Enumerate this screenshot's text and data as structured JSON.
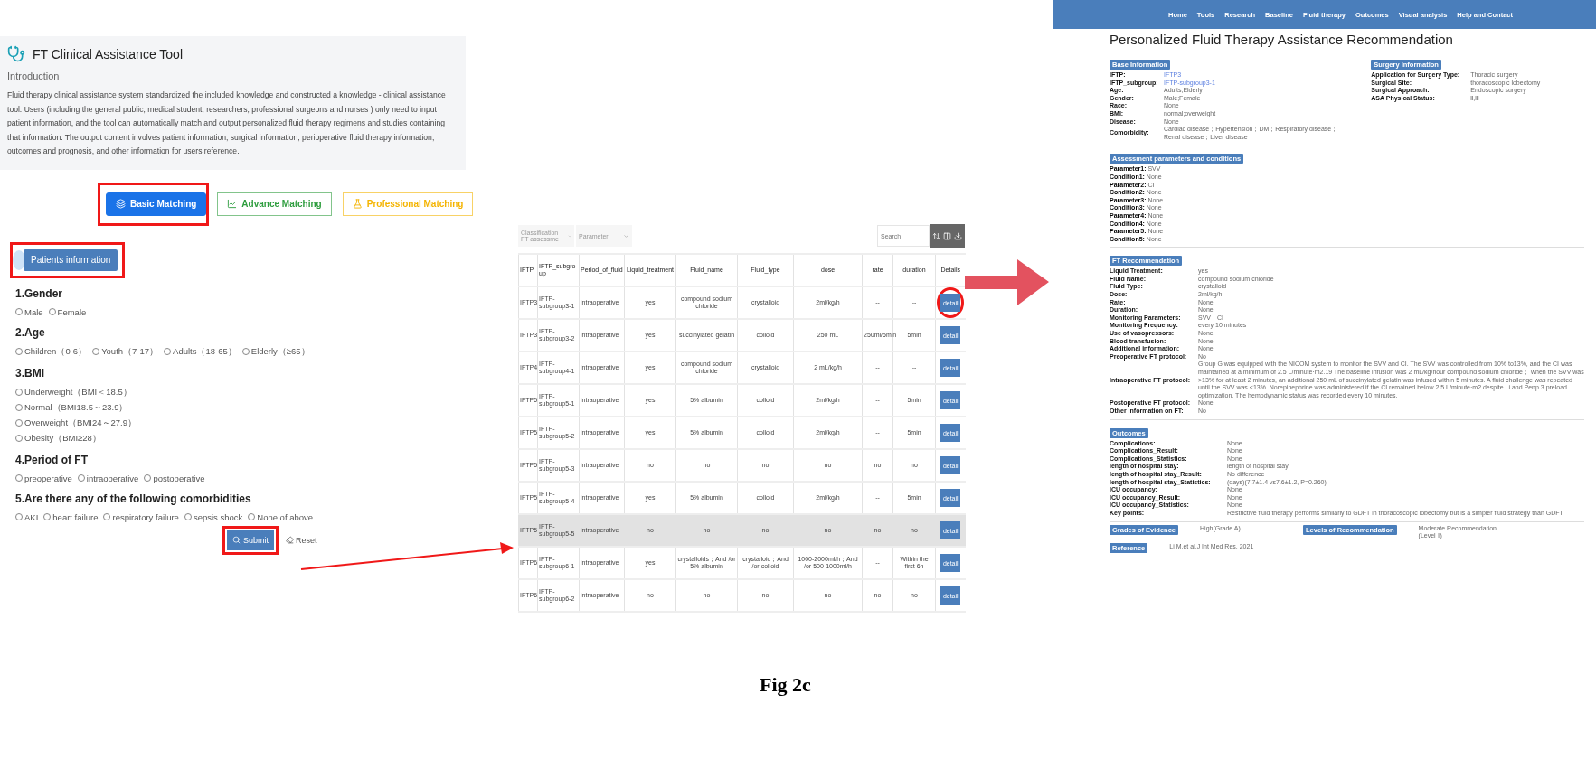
{
  "tool": {
    "title": "FT Clinical Assistance Tool",
    "intro_heading": "Introduction",
    "intro_text": "Fluid therapy clinical assistance system standardized the included knowledge and constructed a knowledge - clinical assistance tool. Users (including the general public, medical student, researchers, professional surgeons and nurses ) only need to input patient information, and the tool can automatically match and output personalized fluid therapy regimens and studies containing that information. The output content involves patient information, surgical information, perioperative fluid therapy information, outcomes and prognosis, and other information for users reference.",
    "modes": [
      {
        "label": "Basic Matching",
        "kind": "layers",
        "color": "#1a73e8",
        "selected": true,
        "annotated": true
      },
      {
        "label": "Advance Matching",
        "kind": "chart",
        "color": "#2e9d3e",
        "selected": false,
        "annotated": false
      },
      {
        "label": "Professional Matching",
        "kind": "flask",
        "color": "#f4b400",
        "selected": false,
        "annotated": false
      }
    ],
    "patients_button": {
      "label": "Patients information",
      "annotated": true
    },
    "questions": [
      {
        "title": "1.Gender",
        "inline": true,
        "options": [
          {
            "label": "Male",
            "selected": false
          },
          {
            "label": "Female",
            "selected": false
          }
        ]
      },
      {
        "title": "2.Age",
        "inline": true,
        "options": [
          {
            "label": "Children（0-6）",
            "selected": false
          },
          {
            "label": "Youth（7-17）",
            "selected": false
          },
          {
            "label": "Adults（18-65）",
            "selected": false
          },
          {
            "label": "Elderly（≥65）",
            "selected": false
          }
        ]
      },
      {
        "title": "3.BMI",
        "inline": false,
        "options": [
          {
            "label": "Underweight（BMI＜18.5）",
            "selected": false
          },
          {
            "label": "Normal（BMI18.5～23.9）",
            "selected": false
          },
          {
            "label": "Overweight（BMI24～27.9）",
            "selected": false
          },
          {
            "label": "Obesity（BMI≥28）",
            "selected": false
          }
        ]
      },
      {
        "title": "4.Period of FT",
        "inline": true,
        "options": [
          {
            "label": "preoperative",
            "selected": false
          },
          {
            "label": "intraoperative",
            "selected": false
          },
          {
            "label": "postoperative",
            "selected": false
          }
        ]
      },
      {
        "title": "5.Are there any of the following comorbidities",
        "inline": true,
        "options": [
          {
            "label": "AKI",
            "selected": false
          },
          {
            "label": "heart failure",
            "selected": false
          },
          {
            "label": "respiratory failure",
            "selected": false
          },
          {
            "label": "sepsis shock",
            "selected": false
          },
          {
            "label": "None of above",
            "selected": false
          }
        ]
      }
    ],
    "submit": {
      "label": "Submit",
      "annotated": true
    },
    "reset": "Reset"
  },
  "table_view": {
    "filters": [
      "Classification FT assessme",
      "Parameter"
    ],
    "search_placeholder": "Search",
    "columns": [
      "IFTP",
      "IFTP_subgroup",
      "Period_of_fluid",
      "Liquid_treatment",
      "Fluid_name",
      "Fluid_type",
      "dose",
      "rate",
      "duration",
      "Details"
    ],
    "rows": [
      {
        "cells": [
          "IFTP3",
          "IFTP-subgroup3-1",
          "intraoperative",
          "yes",
          "compound sodium chloride",
          "crystalloid",
          "2ml/kg/h",
          "--",
          "--"
        ],
        "action": "detail",
        "highlighted": false,
        "annotated": true
      },
      {
        "cells": [
          "IFTP3",
          "IFTP-subgroup3-2",
          "intraoperative",
          "yes",
          "succinylated gelatin",
          "colloid",
          "250 mL",
          "250ml/5min",
          "5min"
        ],
        "action": "detail",
        "highlighted": false,
        "annotated": false
      },
      {
        "cells": [
          "IFTP4",
          "IFTP-subgroup4-1",
          "intraoperative",
          "yes",
          "compound sodium chloride",
          "crystalloid",
          "2 mL/kg/h",
          "--",
          "--"
        ],
        "action": "detail",
        "highlighted": false,
        "annotated": false
      },
      {
        "cells": [
          "IFTP5",
          "IFTP-subgroup5-1",
          "intraoperative",
          "yes",
          "5% albumin",
          "colloid",
          "2ml/kg/h",
          "--",
          "5min"
        ],
        "action": "detail",
        "highlighted": false,
        "annotated": false
      },
      {
        "cells": [
          "IFTP5",
          "IFTP-subgroup5-2",
          "intraoperative",
          "yes",
          "5% albumin",
          "colloid",
          "2ml/kg/h",
          "--",
          "5min"
        ],
        "action": "detail",
        "highlighted": false,
        "annotated": false
      },
      {
        "cells": [
          "IFTP5",
          "IFTP-subgroup5-3",
          "intraoperative",
          "no",
          "no",
          "no",
          "no",
          "no",
          "no"
        ],
        "action": "detail",
        "highlighted": false,
        "annotated": false
      },
      {
        "cells": [
          "IFTP5",
          "IFTP-subgroup5-4",
          "intraoperative",
          "yes",
          "5% albumin",
          "colloid",
          "2ml/kg/h",
          "--",
          "5min"
        ],
        "action": "detail",
        "highlighted": false,
        "annotated": false
      },
      {
        "cells": [
          "IFTP5",
          "IFTP-subgroup5-5",
          "intraoperative",
          "no",
          "no",
          "no",
          "no",
          "no",
          "no"
        ],
        "action": "detail",
        "highlighted": true,
        "annotated": false
      },
      {
        "cells": [
          "IFTP6",
          "IFTP-subgroup6-1",
          "intraoperative",
          "yes",
          "crystalloids；And /or 5% albumin",
          "crystalloid；And /or colloid",
          "1000-2000ml/h；And /or 500-1000ml/h",
          "--",
          "Within the first 6h"
        ],
        "action": "detail",
        "highlighted": false,
        "annotated": false
      },
      {
        "cells": [
          "IFTP6",
          "IFTP-subgroup6-2",
          "intraoperative",
          "no",
          "no",
          "no",
          "no",
          "no",
          "no"
        ],
        "action": "detail",
        "highlighted": false,
        "annotated": false
      }
    ]
  },
  "detail_page": {
    "nav": [
      "Home",
      "Tools",
      "Research",
      "Baseline",
      "Fluid therapy",
      "Outcomes",
      "Visual analysis",
      "Help and Contact"
    ],
    "title": "Personalized Fluid Therapy Assistance Recommendation",
    "base_information": {
      "heading": "Base Information",
      "fields": [
        {
          "label": "IFTP:",
          "value": "IFTP3",
          "kind": "link"
        },
        {
          "label": "IFTP_subgroup:",
          "value": "IFTP-subgroup3-1",
          "kind": "link"
        },
        {
          "label": "Age:",
          "value": "Adults;Elderly",
          "kind": "text"
        },
        {
          "label": "Gender:",
          "value": "Male;Female",
          "kind": "text"
        },
        {
          "label": "Race:",
          "value": "None",
          "kind": "text"
        },
        {
          "label": "BMI:",
          "value": "normal;overweight",
          "kind": "text"
        },
        {
          "label": "Disease:",
          "value": "None",
          "kind": "text"
        },
        {
          "label": "Comorbidity:",
          "value": "Cardiac disease；Hypertension；DM；Respiratory disease；Renal disease；Liver disease",
          "kind": "text"
        }
      ]
    },
    "surgery_information": {
      "heading": "Surgery Information",
      "fields": [
        {
          "label": "Application for Surgery Type:",
          "value": "Thoracic surgery"
        },
        {
          "label": "Surgical Site:",
          "value": "thoracoscopic lobectomy"
        },
        {
          "label": "Surgical Approach:",
          "value": "Endoscopic surgery"
        },
        {
          "label": "ASA Physical Status:",
          "value": "Ⅱ,Ⅲ"
        }
      ]
    },
    "assessment": {
      "heading": "Assessment parameters and conditions",
      "fields": [
        {
          "label": "Parameter1:",
          "value": "SVV"
        },
        {
          "label": "Condition1:",
          "value": "None"
        },
        {
          "label": "Parameter2:",
          "value": "CI"
        },
        {
          "label": "Condition2:",
          "value": "None"
        },
        {
          "label": "Parameter3:",
          "value": "None"
        },
        {
          "label": "Condition3:",
          "value": "None"
        },
        {
          "label": "Parameter4:",
          "value": "None"
        },
        {
          "label": "Condition4:",
          "value": "None"
        },
        {
          "label": "Parameter5:",
          "value": "None"
        },
        {
          "label": "Condition5:",
          "value": "None"
        }
      ]
    },
    "recommendation": {
      "heading": "FT Recommendation",
      "fields": [
        {
          "label": "Liquid Treatment:",
          "value": "yes"
        },
        {
          "label": "Fluid Name:",
          "value": "compound sodium chloride"
        },
        {
          "label": "Fluid Type:",
          "value": "crystalloid"
        },
        {
          "label": "Dose:",
          "value": "2ml/kg/h"
        },
        {
          "label": "Rate:",
          "value": "None"
        },
        {
          "label": "Duration:",
          "value": "None"
        },
        {
          "label": "Monitoring Parameters:",
          "value": "SVV；CI"
        },
        {
          "label": "Monitoring Frequency:",
          "value": "every 10 minutes"
        },
        {
          "label": "Use of vasopressors:",
          "value": "None"
        },
        {
          "label": "Blood transfusion:",
          "value": "None"
        },
        {
          "label": "Additional information:",
          "value": "None"
        },
        {
          "label": "Preoperative FT protocol:",
          "value": "No"
        },
        {
          "label": "Intraoperative FT protocol:",
          "value": "Group G was equipped with the NICOM system to monitor the SVV and CI. The SVV was controlled from 10% to13%, and the CI was maintained at a minimum of 2.5 L/minute·m2.19 The baseline infusion was 2 mL/kg/hour compound sodium chloride； when the SVV was >13% for at least 2 minutes, an additional 250 mL of succinylated gelatin was infused within 5 minutes. A fluid challenge was repeated until the SVV was <13%. Norepinephrine was administered if the CI remained below 2.5 L/minute·m2 despite Li and Penp 3 preload optimization. The hemodynamic status was recorded every 10 minutes."
        },
        {
          "label": "Postoperative FT protocol:",
          "value": "None"
        },
        {
          "label": "Other information on FT:",
          "value": "No"
        }
      ]
    },
    "outcomes": {
      "heading": "Outcomes",
      "fields": [
        {
          "label": "Complications:",
          "value": "None"
        },
        {
          "label": "Complications_Result:",
          "value": "None"
        },
        {
          "label": "Complications_Statistics:",
          "value": "None"
        },
        {
          "label": "length of hospital stay:",
          "value": "length of hospital stay"
        },
        {
          "label": "length of hospital stay_Result:",
          "value": "No difference"
        },
        {
          "label": "length of hospital stay_Statistics:",
          "value": "(days)(7.7±1.4 vs7.6±1.2, P=0.260)"
        },
        {
          "label": "ICU occupancy:",
          "value": "None"
        },
        {
          "label": "ICU occupancy_Result:",
          "value": "None"
        },
        {
          "label": "ICU occupancy_Statistics:",
          "value": "None"
        },
        {
          "label": "Key points:",
          "value": "Restrictive fluid therapy performs similarly to GDFT in thoracoscopic lobectomy but is a simpler fluid strategy than GDFT"
        }
      ]
    },
    "grades": {
      "heading": "Grades of Evidence",
      "value": "High(Grade A)"
    },
    "levels": {
      "heading": "Levels of Recommendation",
      "value": "Moderate Recommendation (Level Ⅱ)"
    },
    "reference": {
      "heading": "Reference",
      "value": "Li M.et al.J Int Med Res. 2021"
    }
  },
  "caption": "Fig 2c"
}
